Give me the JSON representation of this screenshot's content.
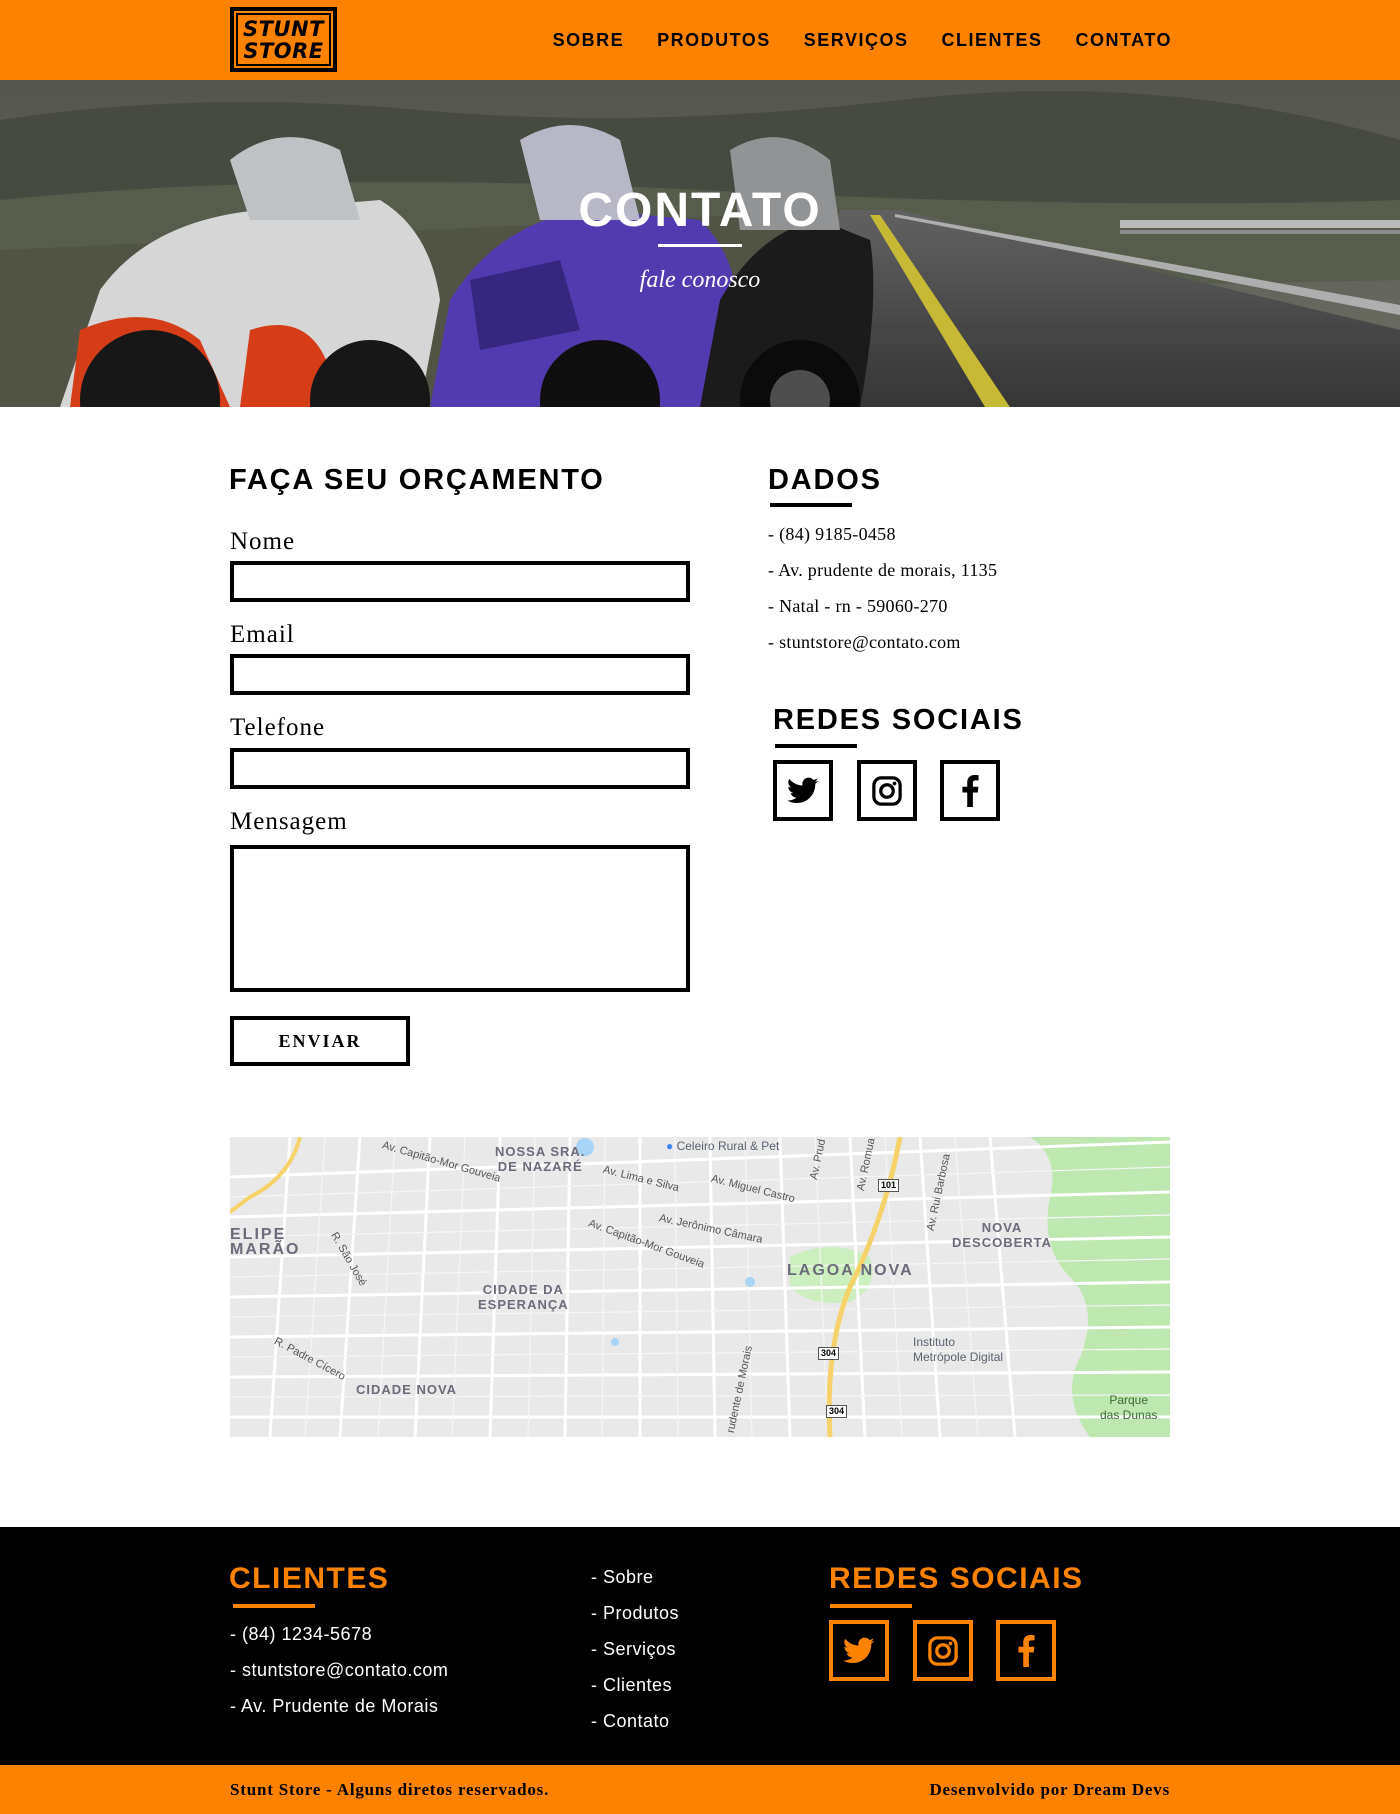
{
  "header": {
    "logo": {
      "line1": "STUNT",
      "line2": "STORE"
    },
    "nav": [
      "SOBRE",
      "PRODUTOS",
      "SERVIÇOS",
      "CLIENTES",
      "CONTATO"
    ]
  },
  "hero": {
    "title": "CONTATO",
    "subtitle": "fale conosco"
  },
  "form": {
    "title": "FAÇA SEU ORÇAMENTO",
    "fields": [
      {
        "label": "Nome",
        "value": ""
      },
      {
        "label": "Email",
        "value": ""
      },
      {
        "label": "Telefone",
        "value": ""
      },
      {
        "label": "Mensagem",
        "value": ""
      }
    ],
    "submit_label": "ENVIAR"
  },
  "dados": {
    "title": "DADOS",
    "lines": [
      "- (84) 9185-0458",
      "- Av. prudente de morais, 1135",
      "- Natal - rn - 59060-270",
      "- stuntstore@contato.com"
    ]
  },
  "redes": {
    "title": "REDES SOCIAIS",
    "icons": [
      "twitter-icon",
      "instagram-icon",
      "facebook-icon"
    ]
  },
  "map": {
    "labels": {
      "nossa_sra": [
        "NOSSA SRA.",
        "DE NAZARÉ"
      ],
      "felipe": [
        "ELIPE",
        "MARÃO"
      ],
      "cidade_esperanca": [
        "CIDADE DA",
        "ESPERANÇA"
      ],
      "lagoa_nova": "LAGOA NOVA",
      "nova_descoberta": [
        "NOVA",
        "DESCOBERTA"
      ],
      "cidade_nova": "CIDADE NOVA",
      "celeiro": "Celeiro Rural & Pet",
      "instituto": [
        "Instituto",
        "Metrópole Digital"
      ],
      "parque": [
        "Parque",
        "das Dunas"
      ],
      "streets": [
        "Av. Capitão-Mor Gouveia",
        "Av. Lima e Silva",
        "Av. Miguel Castro",
        "Av. Jerônimo Câmara",
        "Av. Capitão-Mor Gouveia",
        "R. São José",
        "R. Padre Cícero",
        "Av. Prud",
        "Av. Romua",
        "Av. Rui Barbosa",
        "rudente de Morais"
      ],
      "shields": [
        "101",
        "304",
        "304"
      ]
    }
  },
  "footer": {
    "clientes": {
      "title": "CLIENTES",
      "lines": [
        "- (84) 1234-5678",
        "- stuntstore@contato.com",
        "- Av. Prudente de Morais"
      ]
    },
    "links": [
      "- Sobre",
      "- Produtos",
      "- Serviços",
      "- Clientes",
      "- Contato"
    ],
    "redes": {
      "title": "REDES SOCIAIS",
      "icons": [
        "twitter-icon",
        "instagram-icon",
        "facebook-icon"
      ]
    },
    "copyright": "Stunt Store - Alguns diretos reservados.",
    "credits": "Desenvolvido por Dream Devs"
  },
  "colors": {
    "brand_orange": "#fd8200",
    "black": "#000000",
    "white": "#ffffff"
  }
}
